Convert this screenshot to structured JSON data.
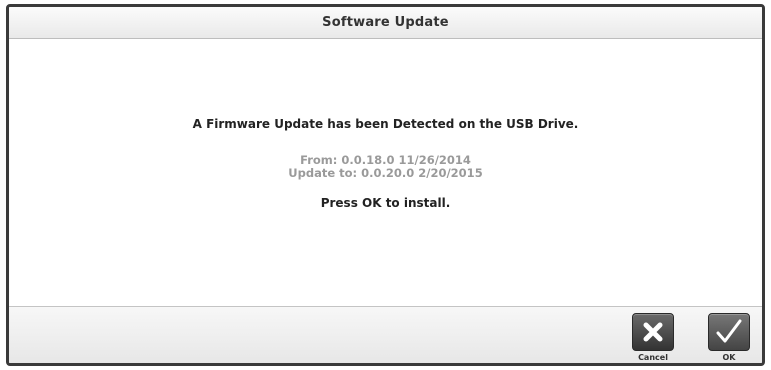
{
  "dialog": {
    "title": "Software Update"
  },
  "message": {
    "main": "A Firmware Update has been Detected on the USB Drive.",
    "from": "From: 0.0.18.0 11/26/2014",
    "update_to": "Update to: 0.0.20.0 2/20/2015",
    "prompt": "Press OK to install."
  },
  "footer": {
    "cancel_label": "Cancel",
    "cancel_icon": "x-icon",
    "ok_label": "OK",
    "ok_icon": "checkmark-icon"
  }
}
